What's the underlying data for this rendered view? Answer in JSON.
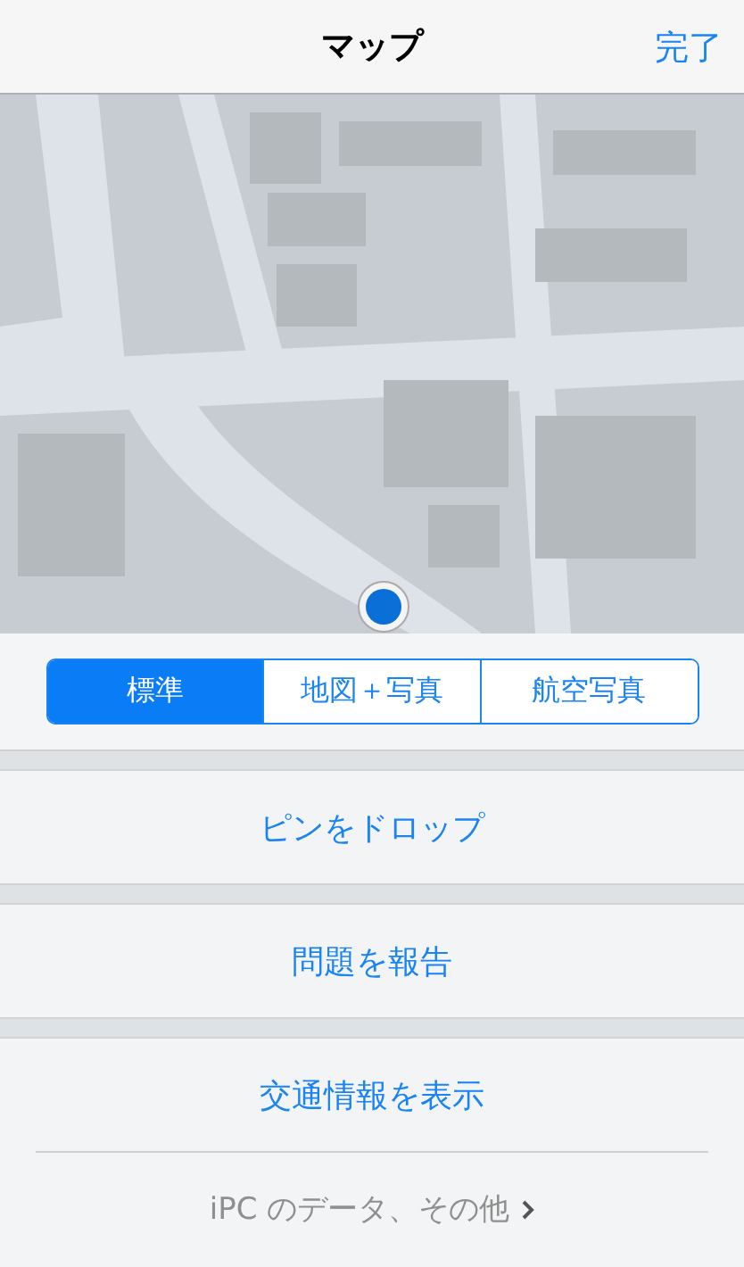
{
  "nav_bar": {
    "title": "マップ",
    "done_button": "完了"
  },
  "map": {
    "kind": "picture"
  },
  "map_type_tabs": [
    {
      "label": "標準",
      "selected": true
    },
    {
      "label": "地図＋写真",
      "selected": false
    },
    {
      "label": "航空写真",
      "selected": false
    }
  ],
  "action_groups": [
    [
      {
        "label": "ピンをドロップ",
        "kind": "button"
      }
    ],
    [
      {
        "label": "問題を報告",
        "kind": "button"
      }
    ],
    [
      {
        "label": "交通情報を表示",
        "kind": "button"
      },
      {
        "label": "iPC のデータ、その他",
        "kind": "link"
      }
    ]
  ]
}
